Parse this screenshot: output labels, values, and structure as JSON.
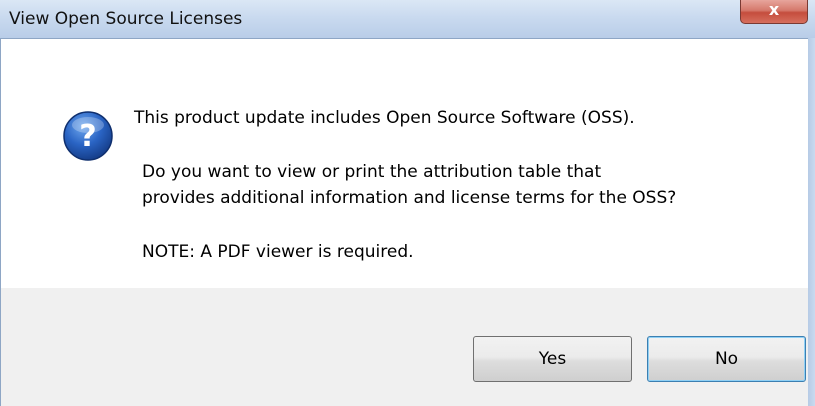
{
  "window": {
    "title": "View Open Source Licenses",
    "close_glyph": "x"
  },
  "message": {
    "icon": "question-icon",
    "line1": "This product update includes Open Source Software (OSS).",
    "line2": "Do you want to view or print the attribution table that",
    "line3": "provides additional information and license terms for the OSS?",
    "line4": "NOTE: A PDF viewer is required."
  },
  "buttons": {
    "yes_label": "Yes",
    "no_label": "No"
  },
  "colors": {
    "titlebar": "#c9daef",
    "close_button": "#c54d3d",
    "icon_blue": "#1f5fb8",
    "default_button_border": "#3c7fb1"
  }
}
